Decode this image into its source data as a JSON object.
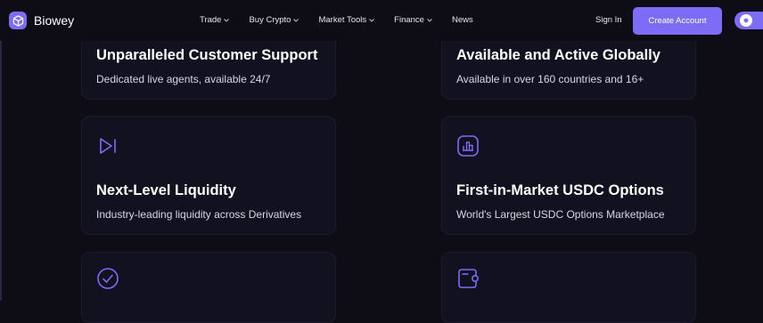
{
  "header": {
    "brand": "Biowey",
    "nav": [
      "Trade",
      "Buy Crypto",
      "Market Tools",
      "Finance",
      "News"
    ],
    "sign_in": "Sign In",
    "create_account": "Create Account"
  },
  "features": [
    {
      "title": "Unparalleled Customer Support",
      "desc": "Dedicated live agents, available 24/7",
      "icon": "none"
    },
    {
      "title": "Available and Active Globally",
      "desc": "Available in over 160 countries and 16+",
      "icon": "none"
    },
    {
      "title": "Next-Level Liquidity",
      "desc": "Industry-leading liquidity across Derivatives",
      "icon": "play-bar-icon"
    },
    {
      "title": "First-in-Market USDC Options",
      "desc": "World's Largest USDC Options Marketplace",
      "icon": "bar-chart-icon"
    },
    {
      "title": "",
      "desc": "",
      "icon": "check-circle-icon"
    },
    {
      "title": "",
      "desc": "",
      "icon": "wallet-icon"
    }
  ],
  "colors": {
    "accent": "#7c6cf6",
    "background": "#0e0d16",
    "card": "#121120"
  }
}
